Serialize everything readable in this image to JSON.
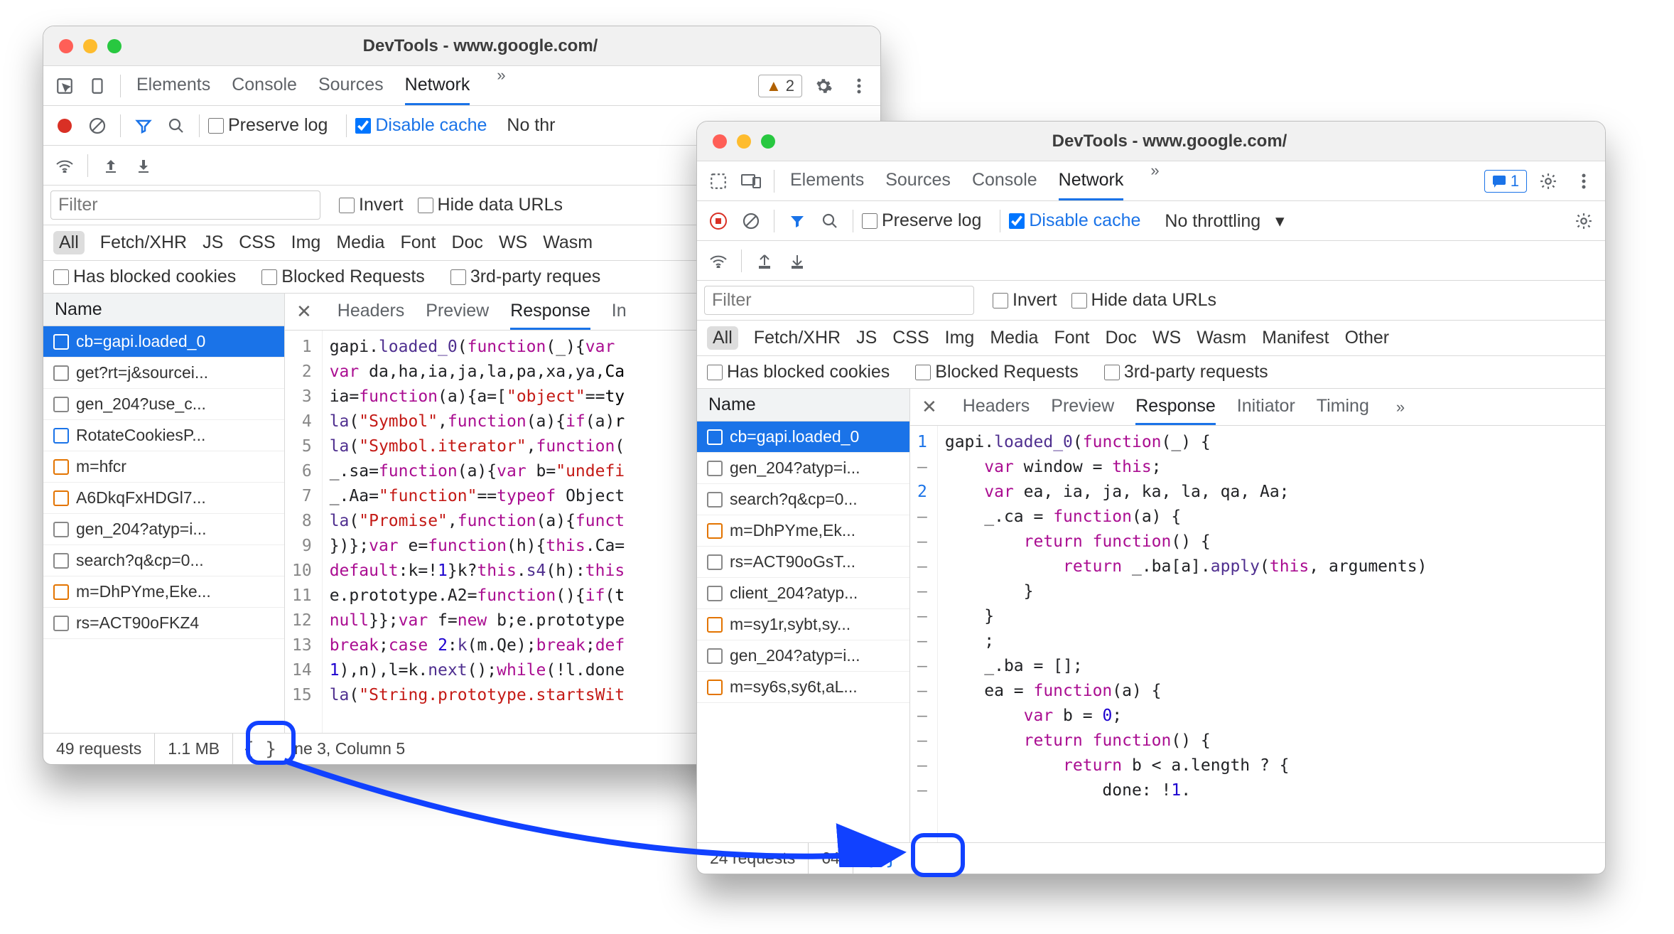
{
  "window": {
    "title": "DevTools - www.google.com/"
  },
  "topbar": {
    "tabs": [
      "Elements",
      "Console",
      "Sources",
      "Network"
    ],
    "active": "Network",
    "tabs_b": [
      "Elements",
      "Sources",
      "Console",
      "Network"
    ],
    "active_b": "Network",
    "more": "»",
    "warn_count": "2",
    "msg_count": "1"
  },
  "toolbar": {
    "preserve": "Preserve log",
    "disable_cache": "Disable cache",
    "throttling_a": "No thr",
    "throttling_b": "No throttling"
  },
  "filter": {
    "placeholder": "Filter",
    "invert": "Invert",
    "hide_data": "Hide data URLs"
  },
  "types": [
    "All",
    "Fetch/XHR",
    "JS",
    "CSS",
    "Img",
    "Media",
    "Font",
    "Doc",
    "WS",
    "Wasm",
    "Manifest",
    "Other"
  ],
  "more_filters": {
    "blocked_cookies": "Has blocked cookies",
    "blocked_requests": "Blocked Requests",
    "third_party": "3rd-party requests",
    "third_party_cut": "3rd-party reques"
  },
  "name_header": "Name",
  "requests_a": [
    {
      "label": "cb=gapi.loaded_0",
      "icon": "orange",
      "sel": true
    },
    {
      "label": "get?rt=j&sourcei...",
      "icon": "grey"
    },
    {
      "label": "gen_204?use_c...",
      "icon": "grey"
    },
    {
      "label": "RotateCookiesP...",
      "icon": "blue"
    },
    {
      "label": "m=hfcr",
      "icon": "orange"
    },
    {
      "label": "A6DkqFxHDGl7...",
      "icon": "orange"
    },
    {
      "label": "gen_204?atyp=i...",
      "icon": "grey"
    },
    {
      "label": "search?q&cp=0...",
      "icon": "grey"
    },
    {
      "label": "m=DhPYme,Eke...",
      "icon": "orange"
    },
    {
      "label": "rs=ACT90oFKZ4",
      "icon": "grey"
    }
  ],
  "requests_b": [
    {
      "label": "cb=gapi.loaded_0",
      "icon": "orange",
      "sel": true
    },
    {
      "label": "gen_204?atyp=i...",
      "icon": "grey"
    },
    {
      "label": "search?q&cp=0...",
      "icon": "grey"
    },
    {
      "label": "m=DhPYme,Ek...",
      "icon": "orange"
    },
    {
      "label": "rs=ACT90oGsT...",
      "icon": "grey"
    },
    {
      "label": "client_204?atyp...",
      "icon": "grey"
    },
    {
      "label": "m=sy1r,sybt,sy...",
      "icon": "orange"
    },
    {
      "label": "gen_204?atyp=i...",
      "icon": "grey"
    },
    {
      "label": "m=sy6s,sy6t,aL...",
      "icon": "orange"
    }
  ],
  "detail_tabs_a": [
    "Headers",
    "Preview",
    "Response",
    "In"
  ],
  "detail_tabs_b": [
    "Headers",
    "Preview",
    "Response",
    "Initiator",
    "Timing",
    "»"
  ],
  "detail_active": "Response",
  "status_a": {
    "reqs": "49 requests",
    "size": "1.1 MB",
    "cursor": "ine 3, Column 5"
  },
  "status_b": {
    "reqs": "24 requests",
    "size": "64"
  },
  "pretty": "{ }",
  "gutter_a": [
    "1",
    "2",
    "3",
    "4",
    "5",
    "6",
    "7",
    "8",
    "9",
    "10",
    "11",
    "12",
    "13",
    "14",
    "15"
  ],
  "gutter_b": [
    [
      "n",
      "1"
    ],
    [
      "m",
      "–"
    ],
    [
      "n",
      "2"
    ],
    [
      "m",
      "–"
    ],
    [
      "m",
      "–"
    ],
    [
      "m",
      "–"
    ],
    [
      "m",
      "–"
    ],
    [
      "m",
      "–"
    ],
    [
      "m",
      "–"
    ],
    [
      "m",
      "–"
    ],
    [
      "m",
      "–"
    ],
    [
      "m",
      "–"
    ],
    [
      "m",
      "–"
    ],
    [
      "m",
      "–"
    ],
    [
      "m",
      "–"
    ]
  ]
}
